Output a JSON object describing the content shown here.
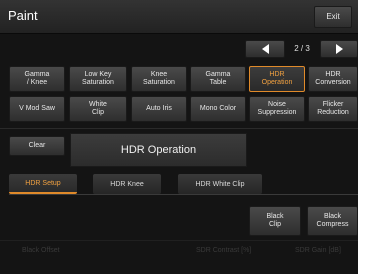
{
  "header": {
    "title": "Paint",
    "exit_label": "Exit"
  },
  "pager": {
    "page_indicator": "2 / 3",
    "prev_icon": "left-triangle-icon",
    "next_icon": "right-triangle-icon"
  },
  "function_grid": {
    "row1": [
      "Gamma\n/ Knee",
      "Low Key\nSaturation",
      "Knee\nSaturation",
      "Gamma\nTable",
      "HDR\nOperation",
      "HDR\nConversion"
    ],
    "row2": [
      "V Mod Saw",
      "White\nClip",
      "Auto Iris",
      "Mono Color",
      "Noise\nSuppression",
      "Flicker\nReduction"
    ],
    "selected": "HDR\nOperation"
  },
  "panel": {
    "clear_label": "Clear",
    "title": "HDR Operation"
  },
  "tabs": [
    {
      "label": "HDR Setup",
      "active": true
    },
    {
      "label": "HDR Knee",
      "active": false
    },
    {
      "label": "HDR White Clip",
      "active": false
    }
  ],
  "actions": {
    "black_clip": "Black\nClip",
    "black_compress": "Black\nCompress"
  },
  "bottom_params": [
    "Black Offset",
    "SDR Contrast [%]",
    "SDR Gain [dB]"
  ],
  "colors": {
    "accent": "#e08a2a",
    "header_bg": "#2a2a2a",
    "screen_bg": "#141414"
  }
}
